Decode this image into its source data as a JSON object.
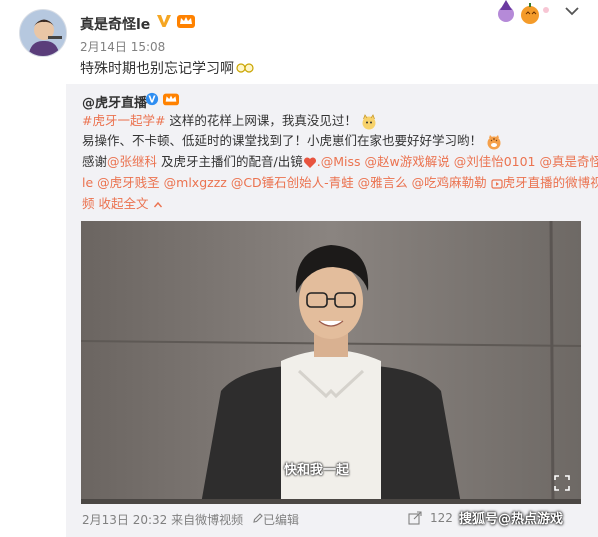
{
  "post": {
    "author": "真是奇怪le",
    "timestamp": "2月14日 15:08",
    "text": "特殊时期也别忘记学习啊",
    "glasses_emoji": "glasses-emoji"
  },
  "repost": {
    "author": "@虎牙直播",
    "hashtag": "#虎牙一起学#",
    "line1_rest": " 这样的花样上网课，我真没见过！",
    "line2": "易操作、不卡顿、低延时的课堂找到了！小虎崽们在家也要好好学习哟！",
    "line3_prefix": "感谢",
    "mention_1": "@张继科",
    "line3_mid": " 及虎牙主播们的配音/出镜",
    "mention_2": ".@Miss",
    "mention_3": "@赵w游戏解说",
    "mention_4": "@刘佳怡0101",
    "mention_5": "@真是奇怪",
    "line4_mention_5_cont": "le",
    "mention_6": "@虎牙贱圣",
    "mention_7": "@mlxgzzz",
    "mention_8": "@CD锤石创始人-青蛙",
    "mention_9": "@雅言么",
    "mention_10": "@吃鸡麻勒勒",
    "video_link": "虎牙直播的微博视",
    "line5_video_cont": "频",
    "collapse": "收起全文",
    "collapse_icon": "chevron-up-icon",
    "video": {
      "subtitle": "快和我一起",
      "progress": 0.0
    },
    "footer": {
      "date": "2月13日 20:32",
      "source_prefix": "来自",
      "source": "微博视频",
      "edited": "已编辑",
      "share_count": "122"
    }
  },
  "watermark": "搜狐号@热点游戏",
  "colors": {
    "link": "#eb7350",
    "verified": "#f5a623",
    "card_bg": "#f2f2f5",
    "muted": "#808080"
  }
}
